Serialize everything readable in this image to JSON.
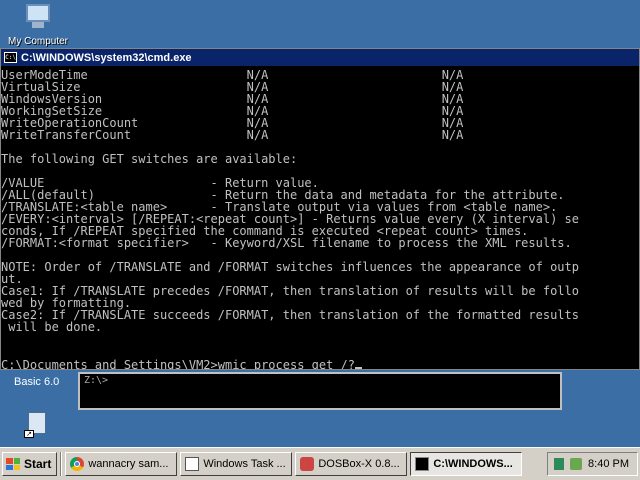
{
  "desktop": {
    "my_computer_label": "My Computer"
  },
  "cmd_window": {
    "title": "C:\\WINDOWS\\system32\\cmd.exe",
    "icon_text": "C:\\",
    "lines": [
      "UserModeTime                      N/A                        N/A",
      "VirtualSize                       N/A                        N/A",
      "WindowsVersion                    N/A                        N/A",
      "WorkingSetSize                    N/A                        N/A",
      "WriteOperationCount               N/A                        N/A",
      "WriteTransferCount                N/A                        N/A",
      "",
      "The following GET switches are available:",
      "",
      "/VALUE                       - Return value.",
      "/ALL(default)                - Return the data and metadata for the attribute.",
      "/TRANSLATE:<table name>      - Translate output via values from <table name>.",
      "/EVERY:<interval> [/REPEAT:<repeat count>] - Returns value every (X interval) se",
      "conds, If /REPEAT specified the command is executed <repeat count> times.",
      "/FORMAT:<format specifier>   - Keyword/XSL filename to process the XML results.",
      "",
      "NOTE: Order of /TRANSLATE and /FORMAT switches influences the appearance of outp",
      "ut.",
      "Case1: If /TRANSLATE precedes /FORMAT, then translation of results will be follo",
      "wed by formatting.",
      "Case2: If /TRANSLATE succeeds /FORMAT, then translation of the formatted results",
      " will be done.",
      "",
      ""
    ],
    "prompt_line": "C:\\Documents and Settings\\VM2>wmic process get /?"
  },
  "dosbox": {
    "label": "Basic 6.0",
    "prompt": "Z:\\>"
  },
  "taskbar": {
    "start_label": "Start",
    "tasks": [
      {
        "label": "wannacry sam...",
        "icon": "chrome-icon",
        "active": false
      },
      {
        "label": "Windows Task ...",
        "icon": "task-manager-icon",
        "active": false
      },
      {
        "label": "DOSBox-X 0.8...",
        "icon": "dosbox-icon",
        "active": false
      },
      {
        "label": "C:\\WINDOWS...",
        "icon": "cmd-icon",
        "active": true
      }
    ],
    "clock": "8:40 PM"
  }
}
